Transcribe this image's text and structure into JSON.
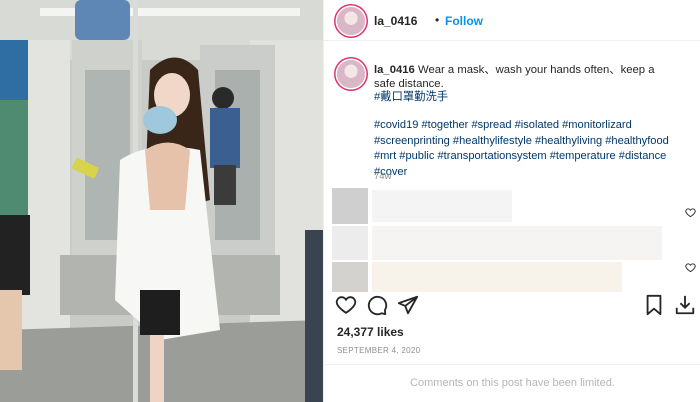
{
  "post": {
    "username": "la_0416",
    "follow_label": "Follow",
    "separator": "•",
    "caption_text": "Wear a mask、wash your hands often、keep a safe distance.",
    "caption_tag_zh": "#戴口罩勤洗手",
    "hashtags": "#covid19 #together #spread #isolated #monitorlizard #screenprinting #healthylifestyle #healthyliving #healthyfood #mrt #public #transportationsystem #temperature #distance #cover",
    "time_ago": "74w",
    "likes": "24,377 likes",
    "date": "SEPTEMBER 4, 2020",
    "comments_limited": "Comments on this post have been limited."
  },
  "icons": {
    "like": "heart-icon",
    "comment": "comment-icon",
    "share": "paper-plane-icon",
    "save": "bookmark-icon",
    "download": "download-icon",
    "comment_like": "small-heart-icon"
  },
  "colors": {
    "link_blue": "#0095f6",
    "hashtag": "#00376b",
    "muted": "#8e8e8e"
  }
}
